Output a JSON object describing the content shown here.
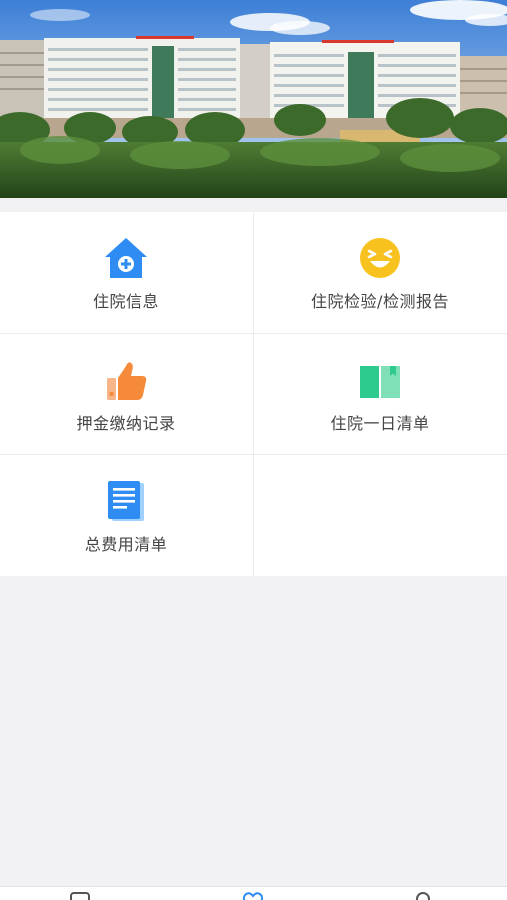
{
  "colors": {
    "background": "#f2f2f4",
    "card": "#ffffff",
    "label_text": "#444444",
    "icon_blue": "#2f8cf2",
    "icon_yellow": "#f8c21e",
    "icon_orange": "#f58a3b",
    "icon_green": "#2ecb8e",
    "tab_active": "#2f8cf2",
    "tab_inactive": "#555555"
  },
  "menu": {
    "items": [
      {
        "label": "住院信息",
        "icon": "hospital-house-icon"
      },
      {
        "label": "住院检验/检测报告",
        "icon": "smiley-face-icon"
      },
      {
        "label": "押金缴纳记录",
        "icon": "thumbs-up-icon"
      },
      {
        "label": "住院一日清单",
        "icon": "open-book-icon"
      },
      {
        "label": "总费用清单",
        "icon": "document-list-icon"
      }
    ]
  },
  "tabbar": {
    "items": [
      {
        "icon": "home-tab-icon",
        "active": false
      },
      {
        "icon": "heart-tab-icon",
        "active": true
      },
      {
        "icon": "profile-tab-icon",
        "active": false
      }
    ]
  }
}
